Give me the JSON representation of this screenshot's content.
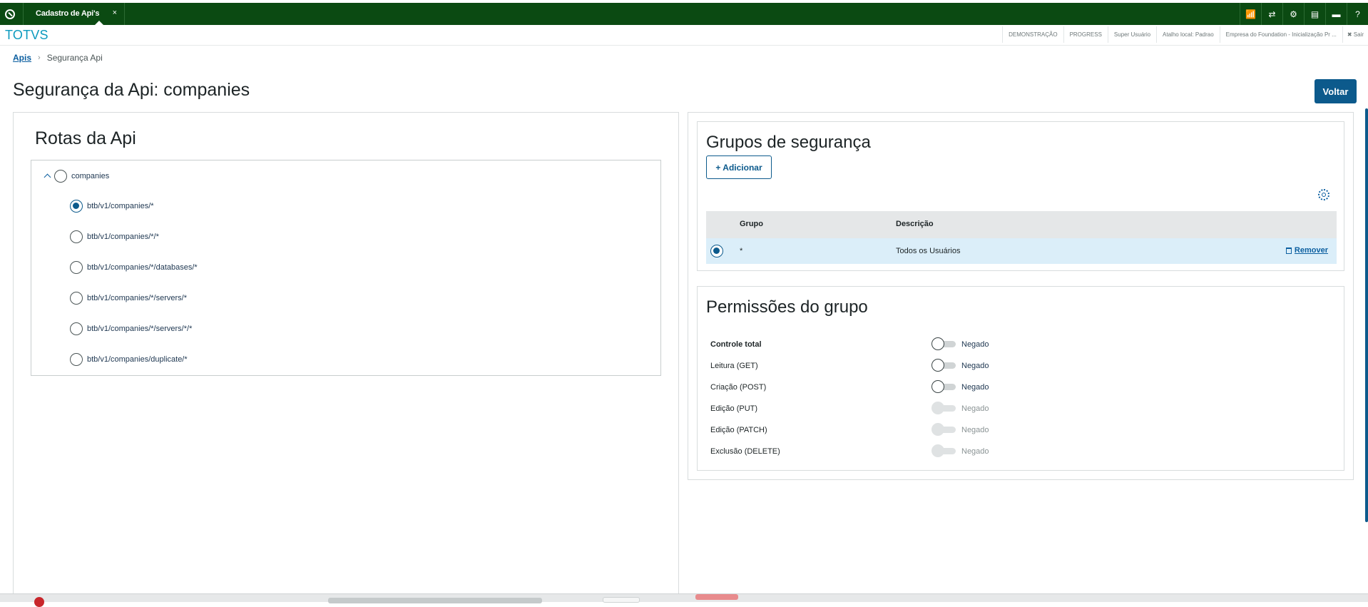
{
  "topbar": {
    "tab_label": "Cadastro de Api's",
    "tab_close": "×",
    "icons": [
      "signal-icon",
      "shuffle-icon",
      "gear-icon",
      "document-icon",
      "chat-icon",
      "help-icon"
    ],
    "icon_glyphs": [
      "📶",
      "⇄",
      "⚙",
      "▤",
      "▬",
      "?"
    ]
  },
  "header": {
    "brand": "TOTVS",
    "info": [
      "DEMONSTRAÇÃO",
      "PROGRESS",
      "Super Usuário",
      "Atalho local: Padrao",
      "Empresa do Foundation - Inicialização Pr ..."
    ],
    "exit_label": "✖ Sair"
  },
  "breadcrumb": {
    "parent": "Apis",
    "separator": "›",
    "current": "Segurança Api"
  },
  "page": {
    "title": "Segurança da Api: companies",
    "back_button": "Voltar"
  },
  "routes_panel": {
    "title": "Rotas da Api",
    "root": "companies",
    "routes": [
      {
        "label": "btb/v1/companies/*",
        "selected": true
      },
      {
        "label": "btb/v1/companies/*/*",
        "selected": false
      },
      {
        "label": "btb/v1/companies/*/databases/*",
        "selected": false
      },
      {
        "label": "btb/v1/companies/*/servers/*",
        "selected": false
      },
      {
        "label": "btb/v1/companies/*/servers/*/*",
        "selected": false
      },
      {
        "label": "btb/v1/companies/duplicate/*",
        "selected": false
      }
    ]
  },
  "groups_panel": {
    "title": "Grupos de segurança",
    "add_button": "+ Adicionar",
    "columns": [
      "Grupo",
      "Descrição"
    ],
    "rows": [
      {
        "group": "*",
        "description": "Todos os Usuários",
        "action": "Remover",
        "selected": true
      }
    ]
  },
  "permissions_panel": {
    "title": "Permissões do grupo",
    "items": [
      {
        "label": "Controle total",
        "state": "Negado",
        "enabled": true,
        "bold": true
      },
      {
        "label": "Leitura (GET)",
        "state": "Negado",
        "enabled": true,
        "bold": false
      },
      {
        "label": "Criação (POST)",
        "state": "Negado",
        "enabled": true,
        "bold": false
      },
      {
        "label": "Edição (PUT)",
        "state": "Negado",
        "enabled": false,
        "bold": false
      },
      {
        "label": "Edição (PATCH)",
        "state": "Negado",
        "enabled": false,
        "bold": false
      },
      {
        "label": "Exclusão (DELETE)",
        "state": "Negado",
        "enabled": false,
        "bold": false
      }
    ]
  },
  "colors": {
    "topbar": "#0b4a12",
    "brand": "#0c9abe",
    "primary": "#0c5a8c",
    "selected_row": "#dbeef9"
  }
}
